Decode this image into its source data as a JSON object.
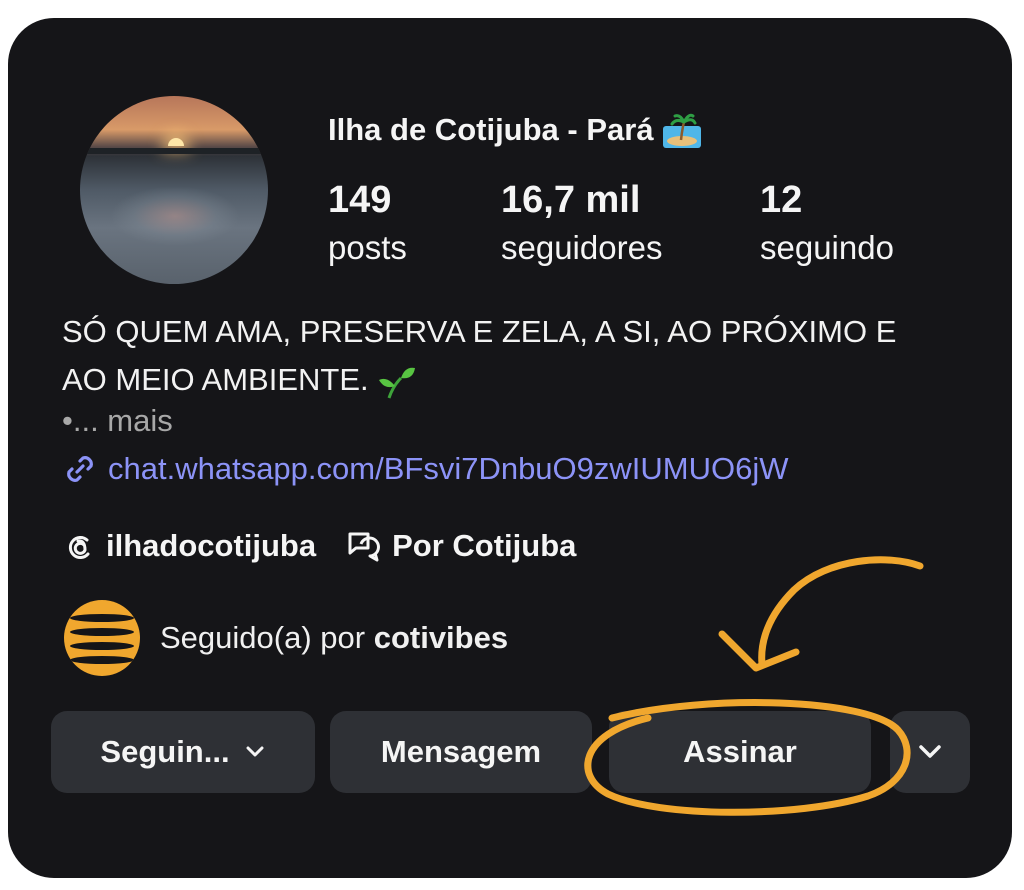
{
  "profile": {
    "name": "Ilha de Cotijuba - Pará",
    "stats": [
      {
        "value": "149",
        "label": "posts"
      },
      {
        "value": "16,7 mil",
        "label": "seguidores"
      },
      {
        "value": "12",
        "label": "seguindo"
      }
    ],
    "bio_line1": "SÓ QUEM AMA, PRESERVA E ZELA, A SI, AO PRÓXIMO E",
    "bio_line2": "AO MEIO AMBIENTE.",
    "more": "•... mais",
    "link": "chat.whatsapp.com/BFsvi7DnbuO9zwIUMUO6jW",
    "threads_handle": "ilhadocotijuba",
    "community": "Por Cotijuba",
    "followed_prefix": "Seguido(a) por",
    "followed_by": "cotivibes"
  },
  "actions": {
    "following": "Seguin...",
    "message": "Mensagem",
    "subscribe": "Assinar"
  },
  "icons": {
    "island": "desert-island-emoji",
    "sprout": "seedling-emoji",
    "link": "link-icon",
    "threads": "threads-icon",
    "community": "chat-bubbles-icon",
    "chevron": "chevron-down-icon"
  },
  "colors": {
    "background": "#151518",
    "button": "#2e3035",
    "link": "#8c93f7",
    "annotation": "#f0a72e"
  }
}
